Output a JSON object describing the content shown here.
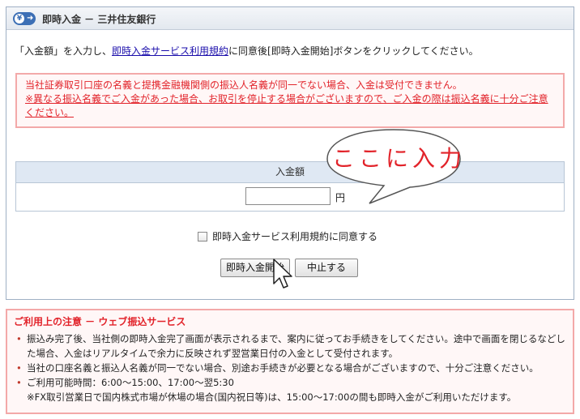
{
  "header": {
    "title": "即時入金 － 三井住友銀行",
    "icon": "yen-transfer-icon"
  },
  "intro": {
    "prefix": "「入金額」を入力し、",
    "link": "即時入金サービス利用規約",
    "suffix": "に同意後[即時入金開始]ボタンをクリックしてください。"
  },
  "warning": {
    "line1": "当社証券取引口座の名義と提携金融機関側の振込人名義が同一でない場合、入金は受付できません。",
    "line2": "※異なる振込名義でご入金があった場合、お取引を停止する場合がございますので、ご入金の際は振込名義に十分ご注意ください。"
  },
  "amount": {
    "header": "入金額",
    "value": "",
    "unit": "円"
  },
  "callout": {
    "text": "ここに入力"
  },
  "agree": {
    "label": "即時入金サービス利用規約に同意する",
    "checked": false
  },
  "buttons": {
    "start": "即時入金開始",
    "stop": "中止する"
  },
  "notes": {
    "title": "ご利用上の注意 － ウェブ振込サービス",
    "items": [
      {
        "text": "振込み完了後、当社側の即時入金完了画面が表示されるまで、案内に従ってお手続きをしてください。途中で画面を閉じるなどした場合、入金はリアルタイムで余力に反映されず翌営業日付の入金として受付されます。"
      },
      {
        "text": "当社の口座名義と振込人名義が同一でない場合、別途お手続きが必要となる場合がございますので、十分ご注意ください。"
      },
      {
        "text": "ご利用可能時間：6:00～15:00、17:00～翌5:30",
        "sub": "※FX取引営業日で国内株式市場が休場の場合(国内祝日等)は、15:00～17:00の間も即時入金がご利用いただけます。"
      }
    ]
  },
  "colors": {
    "warning_red": "#e2232a",
    "panel_border": "#9fb0c4",
    "table_header": "#dfe8f3"
  }
}
